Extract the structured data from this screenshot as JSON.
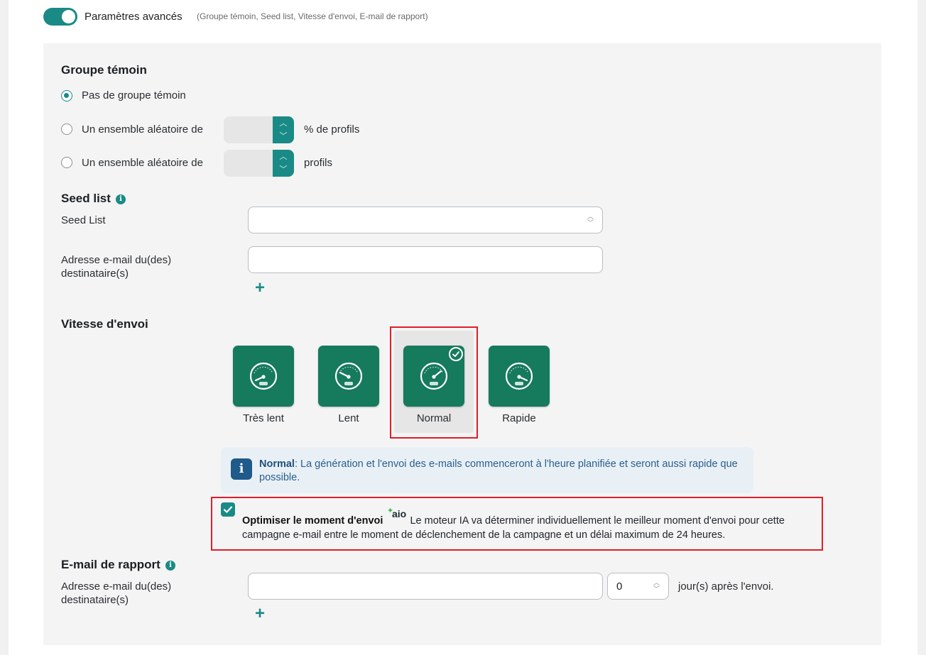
{
  "toggle": {
    "label": "Paramètres avancés",
    "hint": "(Groupe témoin, Seed list, Vitesse d'envoi, E-mail de rapport)",
    "on": true
  },
  "groupe_temoin": {
    "title": "Groupe témoin",
    "options": [
      {
        "label": "Pas de groupe témoin",
        "checked": true
      },
      {
        "label": "Un ensemble aléatoire de",
        "suffix": "% de profils",
        "checked": false
      },
      {
        "label": "Un ensemble aléatoire de",
        "suffix": "profils",
        "checked": false
      }
    ]
  },
  "seed_list": {
    "title": "Seed list",
    "info_icon": "info-icon",
    "seed_label": "Seed List",
    "email_label_line1": "Adresse e-mail du(des)",
    "email_label_line2": "destinataire(s)",
    "add_symbol": "+"
  },
  "vitesse": {
    "title": "Vitesse d'envoi",
    "options": [
      {
        "label": "Très lent",
        "icon": "speedometer-very-slow-icon",
        "selected": false
      },
      {
        "label": "Lent",
        "icon": "speedometer-slow-icon",
        "selected": false
      },
      {
        "label": "Normal",
        "icon": "speedometer-normal-icon",
        "selected": true
      },
      {
        "label": "Rapide",
        "icon": "speedometer-fast-icon",
        "selected": false
      }
    ],
    "info_bold": "Normal",
    "info_text": ": La génération et l'envoi des e-mails commenceront à l'heure planifiée et seront aussi rapide que possible."
  },
  "optimiser": {
    "checked": true,
    "title": "Optimiser le moment d'envoi",
    "badge": "aio",
    "text": " Le moteur IA va déterminer individuellement le meilleur moment d'envoi pour cette campagne e-mail entre le moment de déclenchement de la campagne et un délai maximum de 24 heures."
  },
  "rapport": {
    "title": "E-mail de rapport",
    "email_label_line1": "Adresse e-mail du(des)",
    "email_label_line2": "destinataire(s)",
    "days_value": "0",
    "days_suffix": "jour(s) après l'envoi.",
    "add_symbol": "+"
  },
  "colors": {
    "accent": "#1a8a86",
    "card": "#167a5d",
    "highlight": "#e11d2a",
    "info_bg": "#e8f0f6"
  }
}
